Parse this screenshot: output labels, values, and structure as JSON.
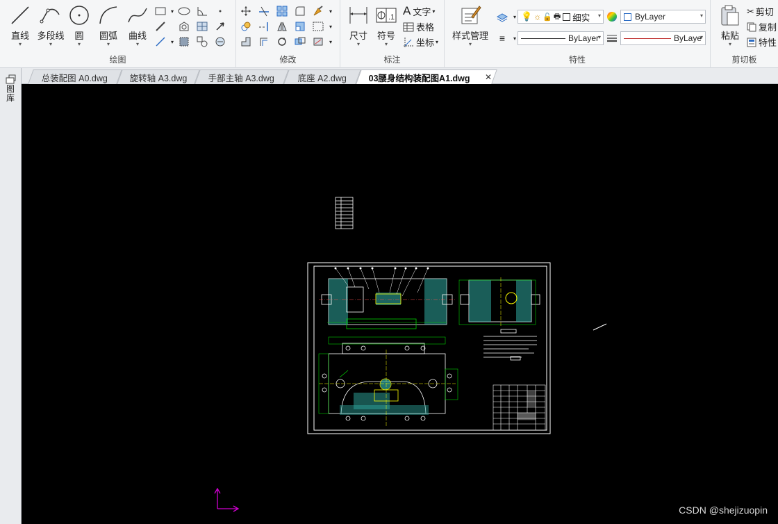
{
  "ribbon": {
    "draw_group": {
      "label": "绘图",
      "line": "直线",
      "polyline": "多段线",
      "circle": "圆",
      "arc": "圆弧",
      "curve": "曲线"
    },
    "modify_group": {
      "label": "修改"
    },
    "annotate_group": {
      "label": "标注",
      "dimension": "尺寸",
      "symbol": "符号",
      "text": "文字",
      "table": "表格",
      "coordinate": "坐标"
    },
    "properties_group": {
      "label": "特性",
      "style_manager": "样式管理",
      "layer_name": "细实",
      "color_value": "ByLayer",
      "linetype_value": "ByLayer",
      "lineweight_value": "ByLaye"
    },
    "clipboard_group": {
      "label": "剪切板",
      "paste": "粘贴",
      "cut": "剪切",
      "copy": "复制",
      "properties": "特性"
    }
  },
  "tabs": [
    {
      "label": "总装配图 A0.dwg"
    },
    {
      "label": "旋转轴 A3.dwg"
    },
    {
      "label": "手部主轴 A3.dwg"
    },
    {
      "label": "底座 A2.dwg"
    },
    {
      "label": "03腰身结构装配图A1.dwg"
    }
  ],
  "active_tab_index": 4,
  "side_panel": {
    "label": "图库"
  },
  "watermark": "CSDN @shejizuopin",
  "colors": {
    "canvas": "#000000",
    "drawing_lines": "#ffffff",
    "hatch": "#2fa9a0",
    "center_lines": "#ffff00",
    "dim_lines": "#00d000",
    "ucs_icon": "#d000d0"
  }
}
